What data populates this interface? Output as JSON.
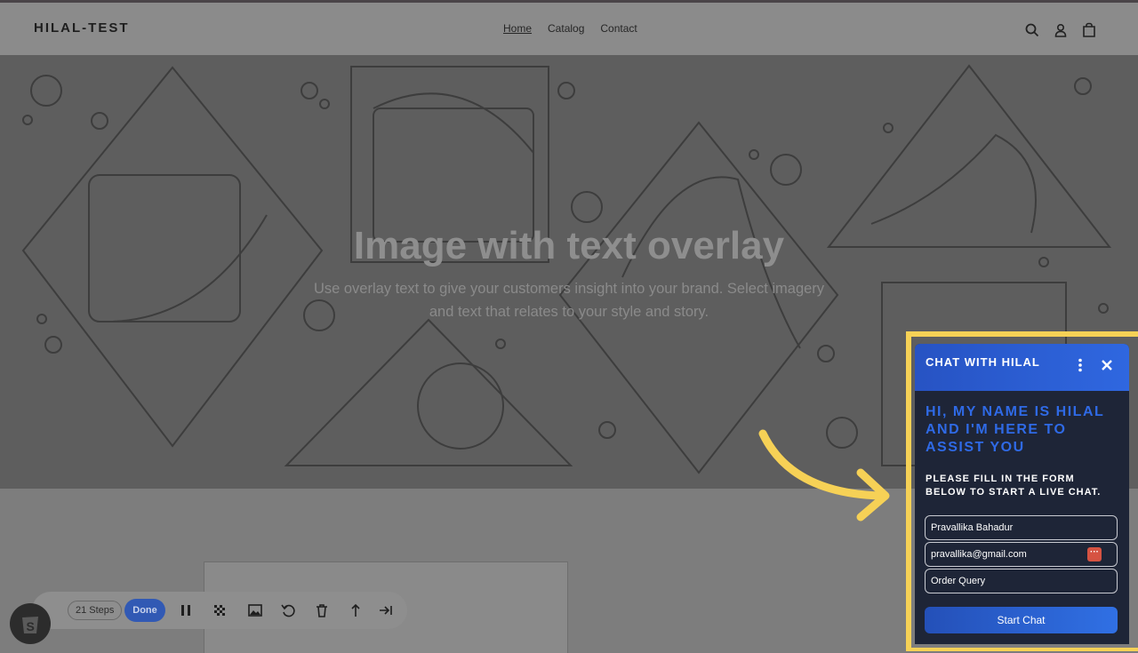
{
  "header": {
    "brand": "HILAL-TEST",
    "nav": [
      {
        "label": "Home"
      },
      {
        "label": "Catalog"
      },
      {
        "label": "Contact"
      }
    ],
    "icons": [
      "search-icon",
      "account-icon",
      "cart-icon"
    ]
  },
  "hero": {
    "title": "Image with text overlay",
    "subtitle": "Use overlay text to give your customers insight into your brand. Select imagery and text that relates to your style and story."
  },
  "toolbar": {
    "steps_label": "21 Steps",
    "done_label": "Done",
    "icons": [
      "pause-icon",
      "blur-icon",
      "image-icon",
      "undo-icon",
      "trash-icon",
      "branch-icon",
      "skip-to-end-icon"
    ]
  },
  "chat": {
    "title": "CHAT WITH HILAL",
    "greeting": "HI, MY NAME IS HILAL AND I'M HERE TO ASSIST YOU",
    "instructions": "PLEASE FILL IN THE FORM BELOW TO START A LIVE CHAT.",
    "name_value": "Pravallika Bahadur",
    "email_value": "pravallika@gmail.com",
    "query_value": "Order Query",
    "start_label": "Start Chat"
  },
  "colors": {
    "accent": "#2f6ae6",
    "highlight": "#f6d156",
    "chat_bg": "#1e2537",
    "done_button": "#3159b4"
  }
}
